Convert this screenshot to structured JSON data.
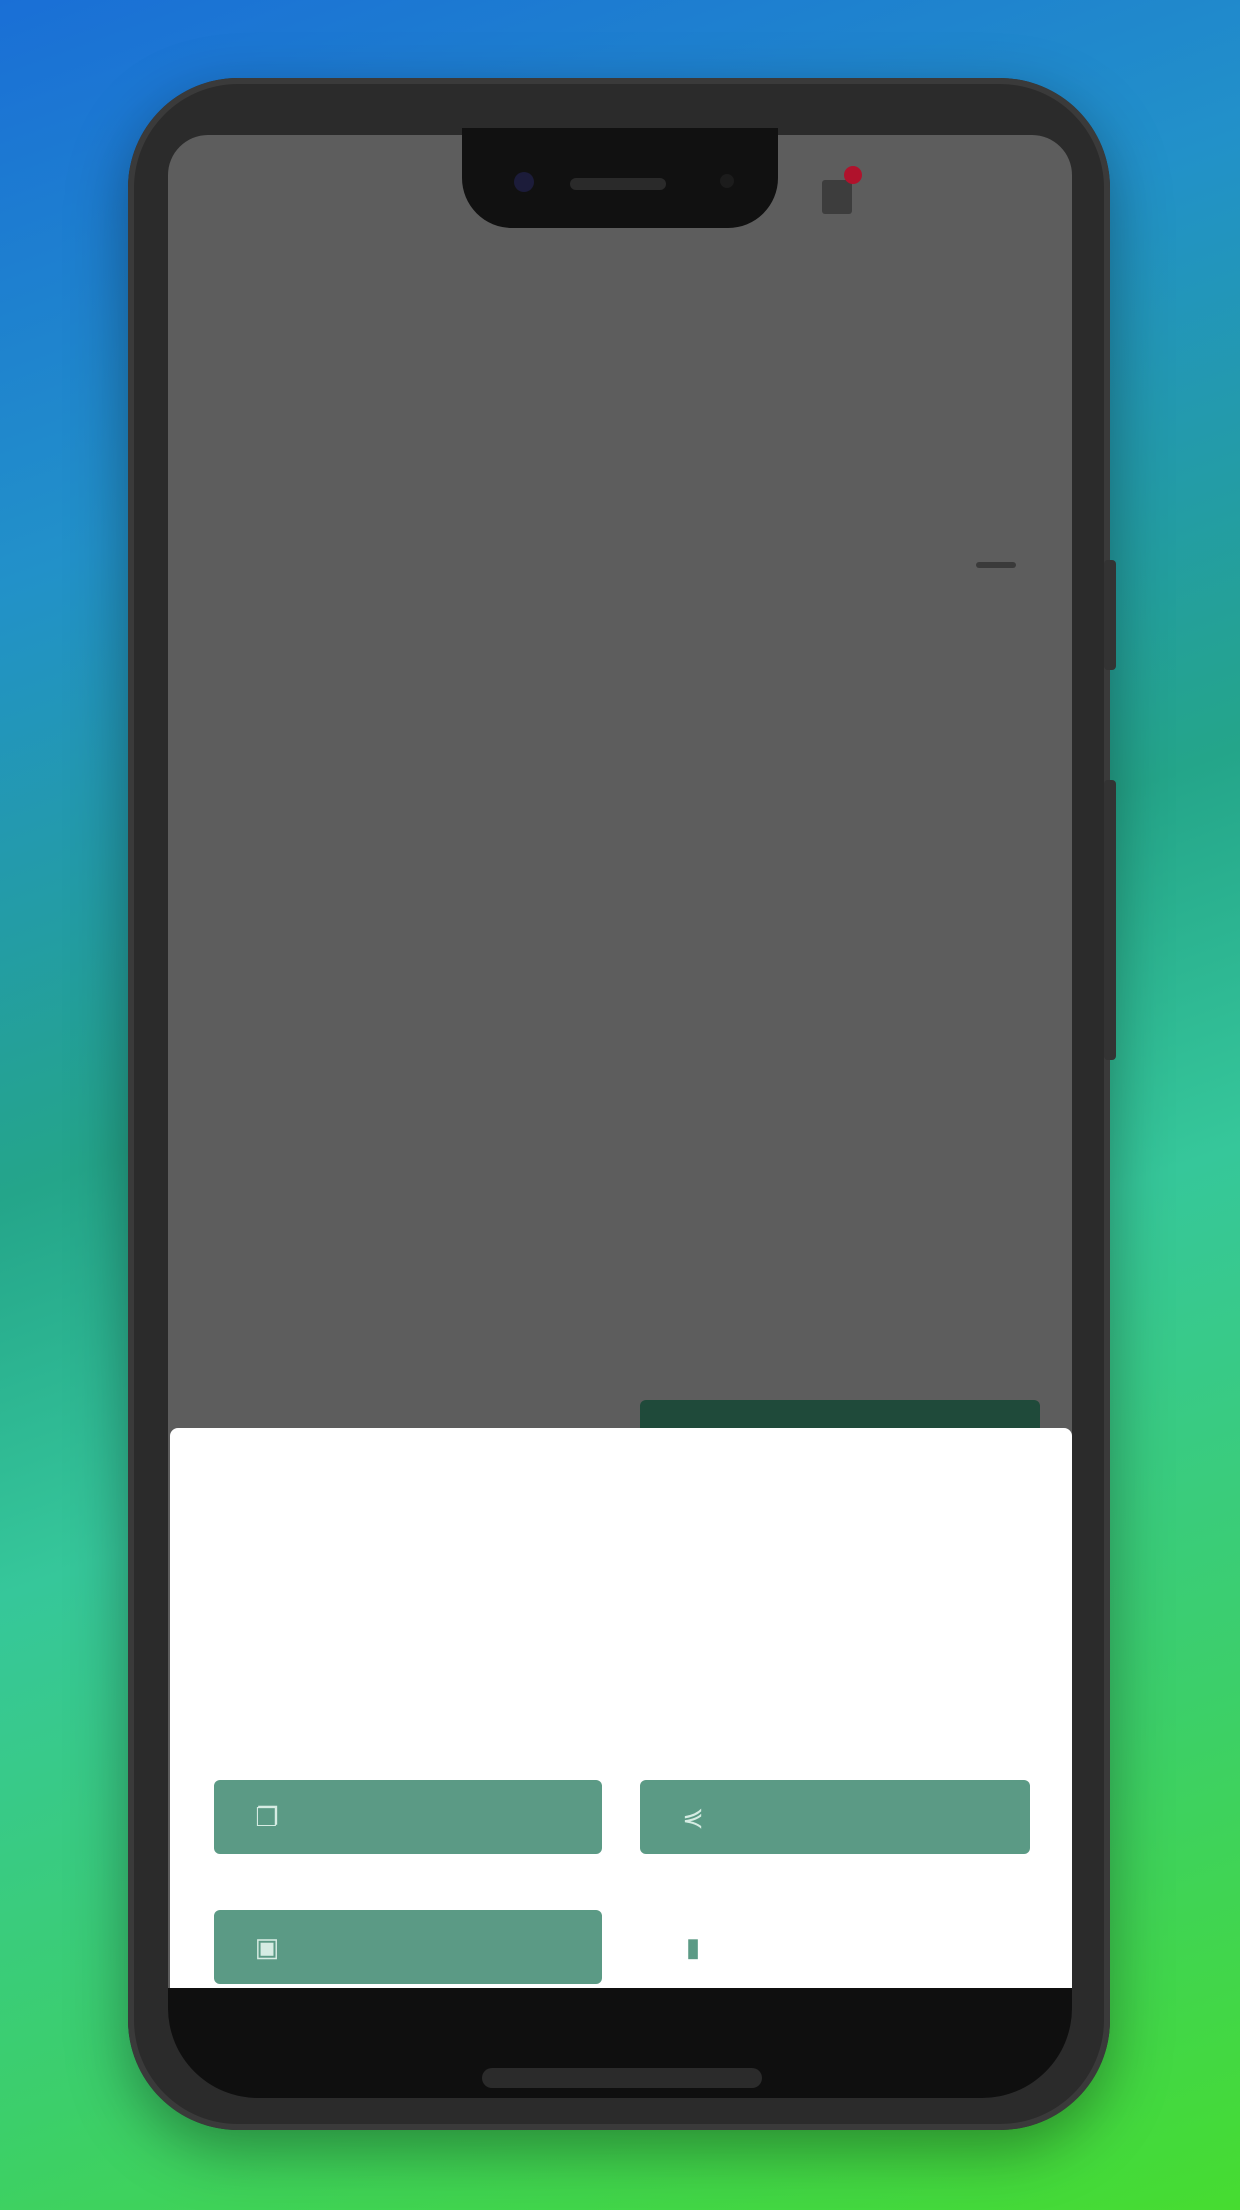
{
  "app": {
    "tabs": [
      "",
      "",
      "",
      "",
      "",
      "",
      ""
    ],
    "fields": [
      {
        "label": "",
        "value": ""
      },
      {
        "label": "",
        "value": ""
      },
      {
        "label": "",
        "value": ""
      },
      {
        "label": "",
        "value": ""
      },
      {
        "label": "",
        "value": ""
      },
      {
        "label": "",
        "value": ""
      }
    ],
    "section_title": ""
  },
  "sheet": {
    "title": "",
    "lines": [
      "",
      "",
      ""
    ],
    "buttons": {
      "copy": {
        "label": "",
        "icon": "copy-icon"
      },
      "share": {
        "label": "",
        "icon": "share-icon"
      },
      "save": {
        "label": "",
        "icon": "image-icon"
      },
      "fourth": {
        "label": "",
        "icon": "phone-icon"
      }
    }
  },
  "colors": {
    "accent": "#5b9a85",
    "screen_dim": "#5d5d5d",
    "notification_dot": "#b0122c"
  }
}
